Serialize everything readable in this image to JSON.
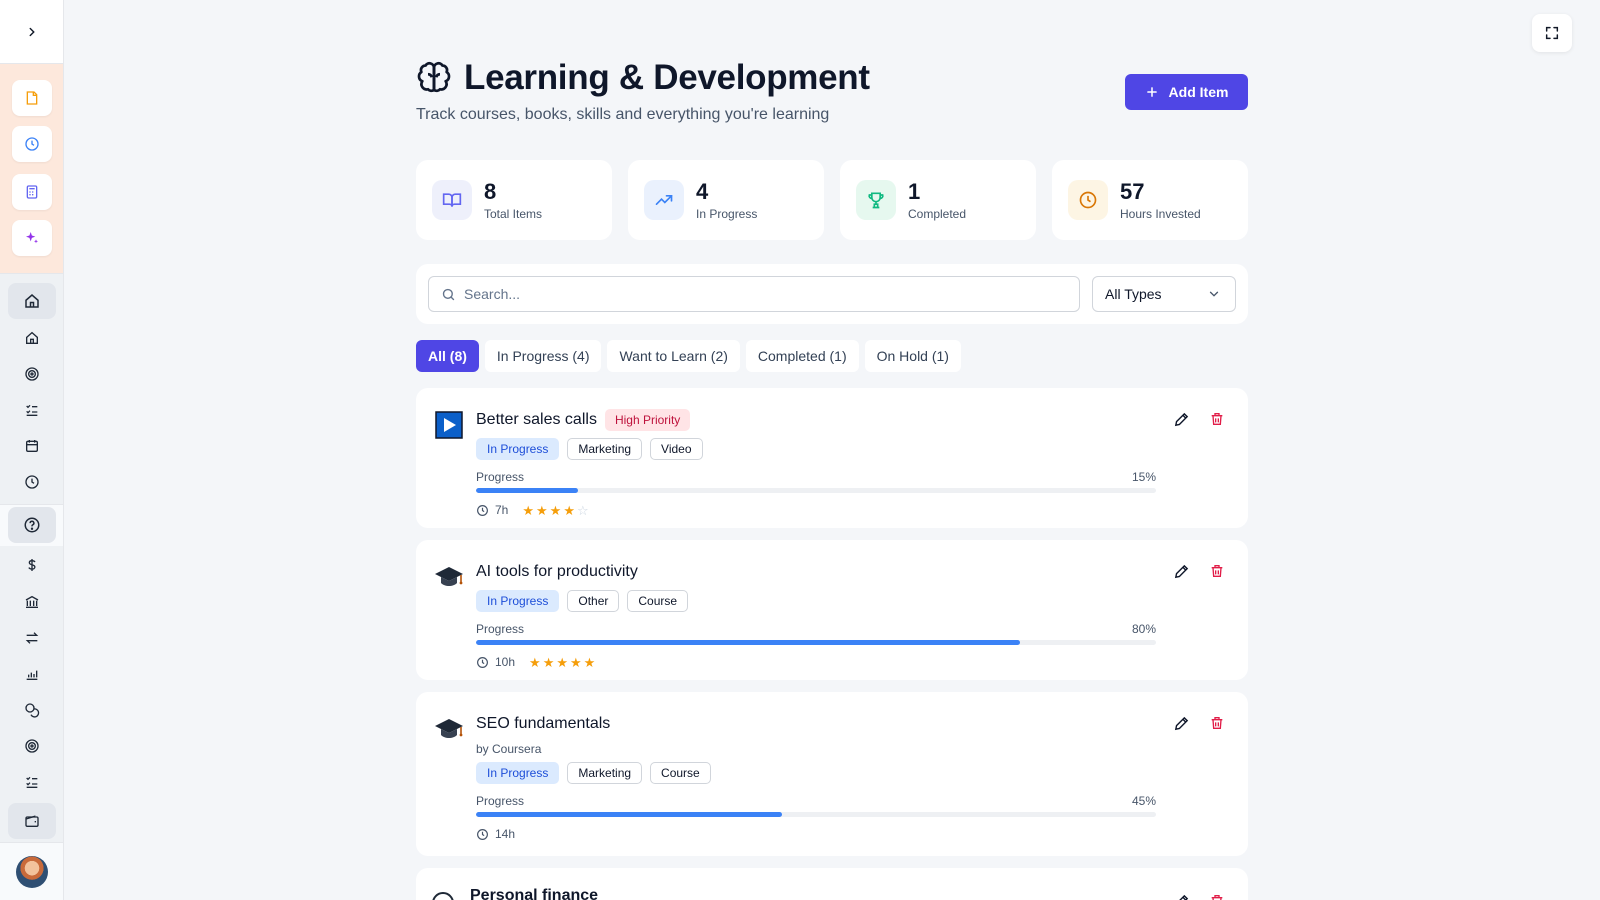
{
  "header": {
    "title": "Learning & Development",
    "subtitle": "Track courses, books, skills and everything you're learning",
    "add_label": "Add Item"
  },
  "stats": [
    {
      "value": "8",
      "label": "Total Items",
      "icon": "book-open-icon",
      "color": "#6366f1"
    },
    {
      "value": "4",
      "label": "In Progress",
      "icon": "trending-up-icon",
      "color": "#3b82f6"
    },
    {
      "value": "1",
      "label": "Completed",
      "icon": "trophy-icon",
      "color": "#10b981"
    },
    {
      "value": "57",
      "label": "Hours Invested",
      "icon": "clock-icon",
      "color": "#d97706"
    }
  ],
  "search": {
    "placeholder": "Search...",
    "type_filter": "All Types"
  },
  "tabs": [
    "All (8)",
    "In Progress (4)",
    "Want to Learn (2)",
    "Completed (1)",
    "On Hold (1)"
  ],
  "progress_label": "Progress",
  "items": [
    {
      "title": "Better sales calls",
      "priority": "High Priority",
      "status": "In Progress",
      "category": "Marketing",
      "type": "Video",
      "progress": 15,
      "progress_text": "15%",
      "hours": "7h",
      "rating": 4,
      "icon": "video-play-icon"
    },
    {
      "title": "AI tools for productivity",
      "status": "In Progress",
      "category": "Other",
      "type": "Course",
      "progress": 80,
      "progress_text": "80%",
      "hours": "10h",
      "rating": 5,
      "icon": "graduation-cap-icon"
    },
    {
      "title": "SEO fundamentals",
      "by": "by Coursera",
      "status": "In Progress",
      "category": "Marketing",
      "type": "Course",
      "progress": 45,
      "progress_text": "45%",
      "hours": "14h",
      "icon": "graduation-cap-icon"
    },
    {
      "title": "Personal finance",
      "icon": "graduation-cap-icon"
    }
  ],
  "colors": {
    "accent": "#4f46e5",
    "progress": "#3b82f6",
    "danger": "#e11d48",
    "star": "#f59e0b"
  }
}
